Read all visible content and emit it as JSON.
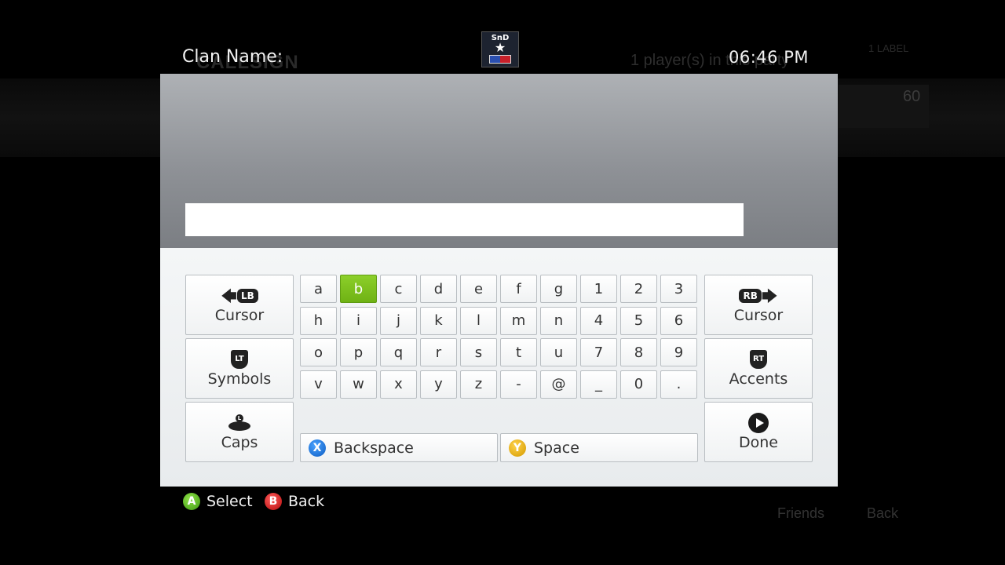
{
  "header": {
    "title": "Clan Name:",
    "clock": "06:46   PM",
    "gamerpic_text": "SnD"
  },
  "background": {
    "callsign": "CALLSIGN",
    "players": "1 player(s) in this party",
    "level": "60",
    "friends": "Friends",
    "back": "Back",
    "top_right": "1 LABEL"
  },
  "input": {
    "value": ""
  },
  "keys": {
    "row1": [
      "a",
      "b",
      "c",
      "d",
      "e",
      "f",
      "g",
      "1",
      "2",
      "3"
    ],
    "row2": [
      "h",
      "i",
      "j",
      "k",
      "l",
      "m",
      "n",
      "4",
      "5",
      "6"
    ],
    "row3": [
      "o",
      "p",
      "q",
      "r",
      "s",
      "t",
      "u",
      "7",
      "8",
      "9"
    ],
    "row4": [
      "v",
      "w",
      "x",
      "y",
      "z",
      "-",
      "@",
      "_",
      "0",
      "."
    ],
    "selected": "b"
  },
  "function_keys": {
    "cursor_left": {
      "label": "Cursor",
      "button": "LB"
    },
    "symbols": {
      "label": "Symbols",
      "button": "LT"
    },
    "caps": {
      "label": "Caps",
      "button": "L"
    },
    "cursor_right": {
      "label": "Cursor",
      "button": "RB"
    },
    "accents": {
      "label": "Accents",
      "button": "RT"
    },
    "done": {
      "label": "Done"
    },
    "backspace": {
      "label": "Backspace",
      "button": "X"
    },
    "space": {
      "label": "Space",
      "button": "Y"
    }
  },
  "footer": {
    "select": {
      "label": "Select",
      "button": "A"
    },
    "back": {
      "label": "Back",
      "button": "B"
    }
  },
  "colors": {
    "selected_key": "#7bc11e",
    "panel_light": "#eef0f2",
    "panel_grey": "#8e9196"
  }
}
